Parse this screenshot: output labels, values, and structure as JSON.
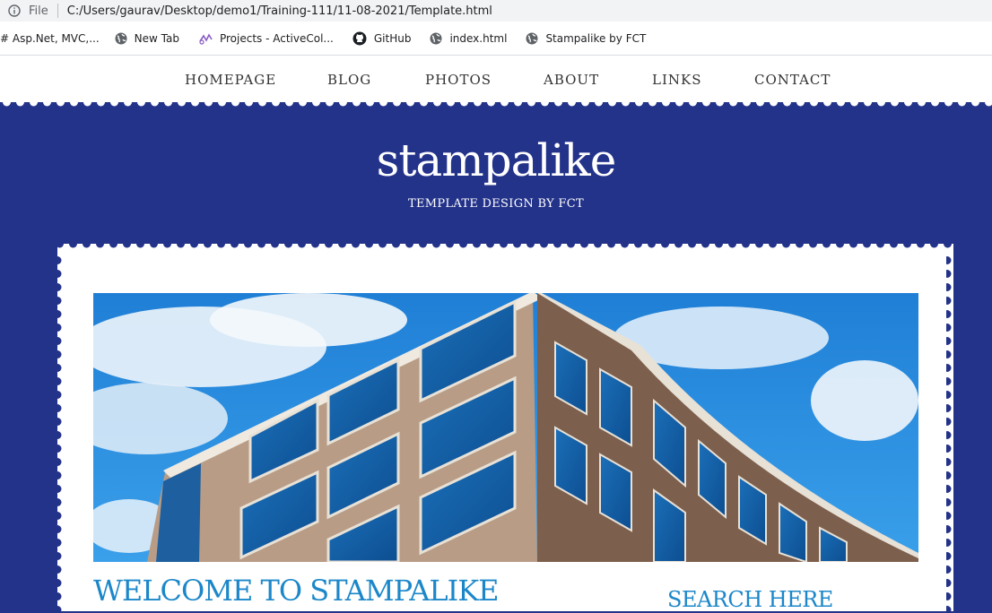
{
  "browser": {
    "file_label": "File",
    "url": "C:/Users/gaurav/Desktop/demo1/Training-111/11-08-2021/Template.html",
    "bookmarks": [
      {
        "label": "# Asp.Net, MVC,...",
        "icon": "none"
      },
      {
        "label": "New Tab",
        "icon": "globe-icon"
      },
      {
        "label": "Projects - ActiveCol...",
        "icon": "projects-icon"
      },
      {
        "label": "GitHub",
        "icon": "github-icon"
      },
      {
        "label": "index.html",
        "icon": "globe-icon"
      },
      {
        "label": "Stampalike by FCT",
        "icon": "globe-icon"
      }
    ]
  },
  "nav": {
    "items": [
      "HOMEPAGE",
      "BLOG",
      "PHOTOS",
      "ABOUT",
      "LINKS",
      "CONTACT"
    ]
  },
  "header": {
    "title": "stampalike",
    "subtitle": "TEMPLATE DESIGN BY FCT"
  },
  "content": {
    "welcome": "WELCOME TO STAMPALIKE",
    "search_heading": "SEARCH HERE"
  },
  "colors": {
    "brand_blue": "#24338a",
    "heading_blue": "#1b87c9"
  }
}
